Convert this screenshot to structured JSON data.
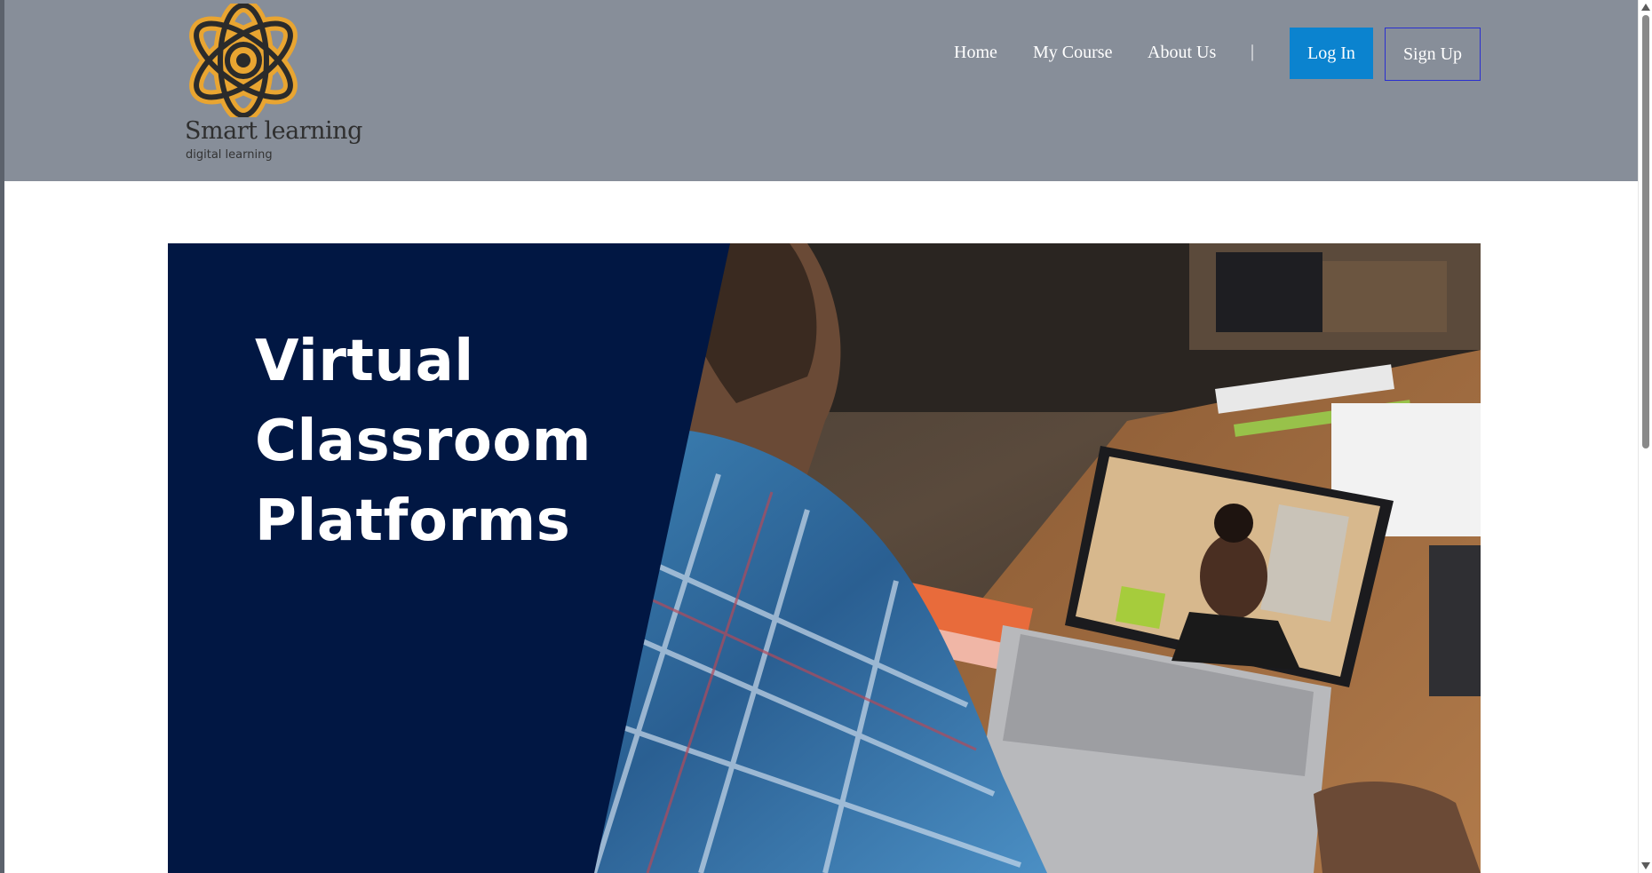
{
  "brand": {
    "name": "Smart learning",
    "tagline": "digital learning",
    "colors": {
      "ring": "#e9a531",
      "mark": "#2b2b2b"
    }
  },
  "nav": {
    "items": [
      {
        "label": "Home"
      },
      {
        "label": "My Course"
      },
      {
        "label": "About Us"
      }
    ],
    "separator": "|",
    "login_label": "Log In",
    "signup_label": "Sign Up"
  },
  "hero": {
    "lines": [
      "Virtual",
      "Classroom",
      "Platforms"
    ],
    "colors": {
      "panel": "#011743",
      "text": "#ffffff"
    }
  },
  "theme": {
    "header_bg": "#878e99",
    "login_bg": "#0b83cf",
    "signup_border": "#2a2fcf"
  }
}
